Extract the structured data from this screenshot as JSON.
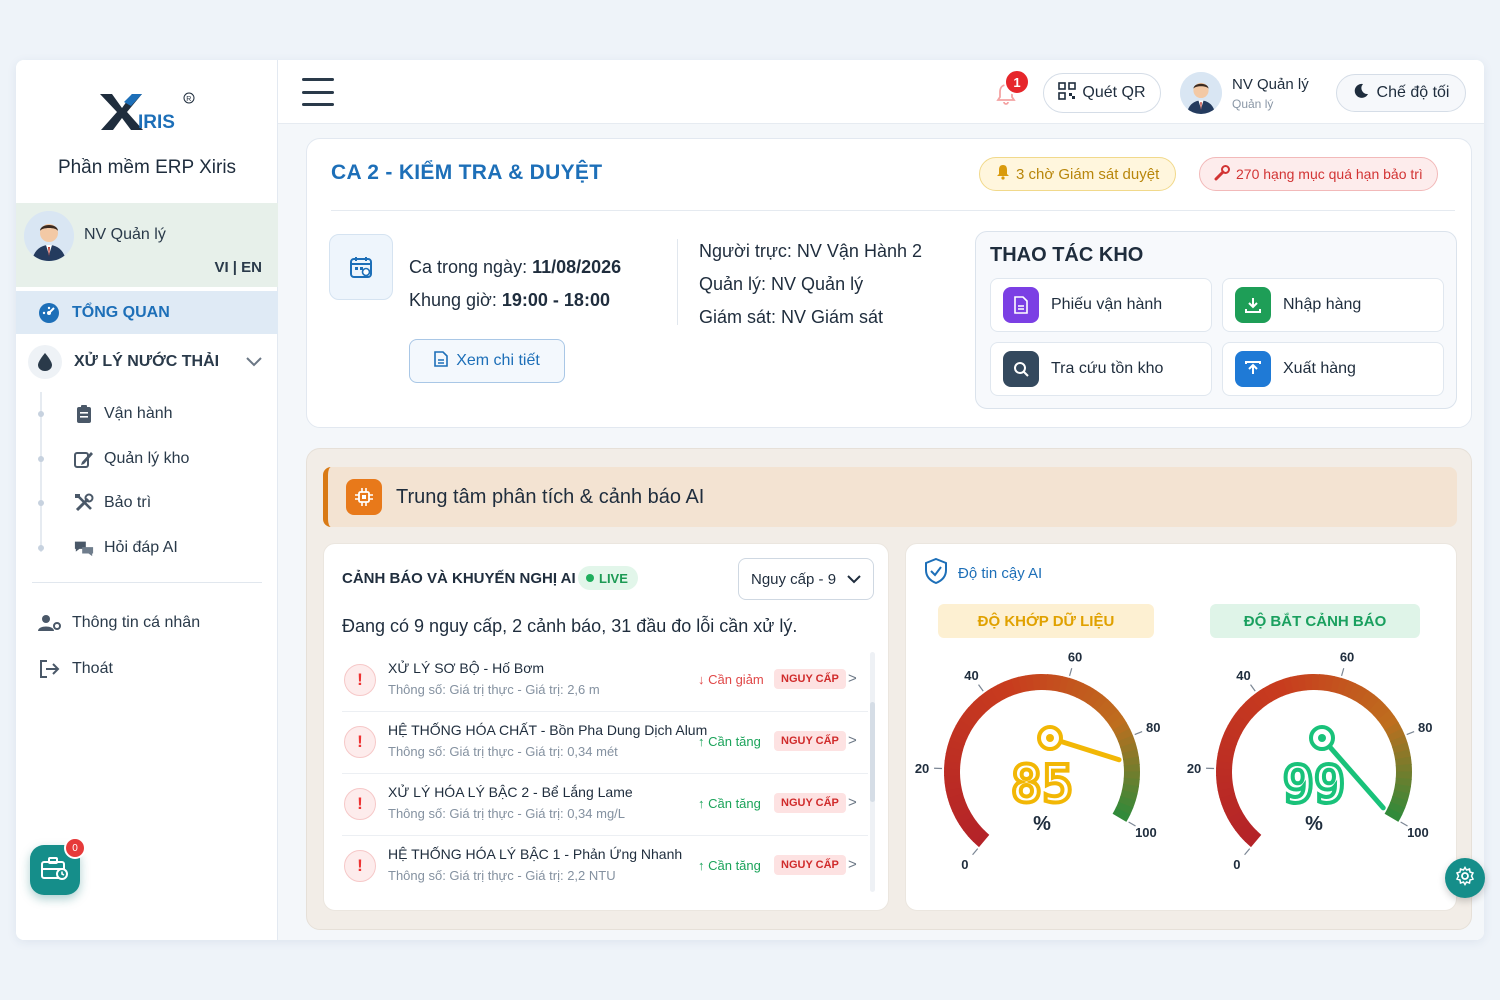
{
  "brand": {
    "logo_text": "XIRIS",
    "app_name": "Phần mềm ERP Xiris"
  },
  "sidebar": {
    "user_name": "NV Quản lý",
    "lang": "VI | EN",
    "overview": "TỔNG QUAN",
    "group": "XỬ LÝ NƯỚC THẢI",
    "sub_items": [
      "Vận hành",
      "Quản lý kho",
      "Bảo trì",
      "Hỏi đáp AI"
    ],
    "profile": "Thông tin cá nhân",
    "logout": "Thoát",
    "fab_badge": "0"
  },
  "topbar": {
    "notif_count": "1",
    "qr_label": "Quét QR",
    "user_name": "NV Quản lý",
    "user_role": "Quản lý",
    "dark_mode": "Chế độ tối"
  },
  "shift": {
    "title": "CA 2 - KIỂM TRA & DUYỆT",
    "pending_badge": "3 chờ Giám sát duyệt",
    "overdue_badge": "270 hạng mục quá hạn bảo trì",
    "date_label": "Ca trong ngày:",
    "date_value": "11/08/2026",
    "time_label": "Khung giờ:",
    "time_value": "19:00 - 18:00",
    "on_duty": "Người trực: NV Vận Hành 2",
    "manager": "Quản lý: NV Quản lý",
    "supervisor": "Giám sát: NV Giám sát",
    "detail_button": "Xem chi tiết"
  },
  "warehouse": {
    "title": "THAO TÁC KHO",
    "actions": [
      {
        "label": "Phiếu vận hành",
        "color": "#7b3fe4"
      },
      {
        "label": "Nhập hàng",
        "color": "#1e9e57"
      },
      {
        "label": "Tra cứu tồn kho",
        "color": "#34495e"
      },
      {
        "label": "Xuất hàng",
        "color": "#1f7ad6"
      }
    ]
  },
  "ai": {
    "title": "Trung tâm phân tích & cảnh báo AI",
    "alerts_title": "CẢNH BÁO VÀ KHUYẾN NGHỊ AI",
    "live": "LIVE",
    "filter": "Nguy cấp - 9",
    "summary": "Đang có 9 nguy cấp, 2 cảnh báo, 31 đầu đo lỗi cần xử lý.",
    "alerts": [
      {
        "title": "XỬ LÝ SƠ BỘ - Hố Bơm",
        "sub": "Thông số: Giá trị thực - Giá trị: 2,6 m",
        "dir": "↓ Cần giảm",
        "dir_color": "#e04848",
        "tag": "NGUY CẤP"
      },
      {
        "title": "HỆ THỐNG HÓA CHẤT - Bồn Pha Dung Dịch Alum",
        "sub": "Thông số: Giá trị thực - Giá trị: 0,34 mét",
        "dir": "↑ Cần tăng",
        "dir_color": "#1ba35a",
        "tag": "NGUY CẤP"
      },
      {
        "title": "XỬ LÝ HÓA LÝ BẬC 2 - Bể Lắng Lame",
        "sub": "Thông số: Giá trị thực - Giá trị: 0,34 mg/L",
        "dir": "↑ Cần tăng",
        "dir_color": "#1ba35a",
        "tag": "NGUY CẤP"
      },
      {
        "title": "HỆ THỐNG HÓA LÝ BẬC 1 - Phản Ứng Nhanh",
        "sub": "Thông số: Giá trị thực - Giá trị: 2,2 NTU",
        "dir": "↑ Cần tăng",
        "dir_color": "#1ba35a",
        "tag": "NGUY CẤP"
      }
    ],
    "trust_title": "Độ tin cậy AI",
    "gauges": [
      {
        "label": "ĐỘ KHỚP DỮ LIỆU",
        "value": 85,
        "unit": "%",
        "color": "#f2b705",
        "label_bg": "#fdf0d2",
        "label_color": "#e0a100",
        "ticks": [
          "0",
          "20",
          "40",
          "60",
          "80",
          "100"
        ]
      },
      {
        "label": "ĐỘ BẮT CẢNH BÁO",
        "value": 99,
        "unit": "%",
        "color": "#19c27a",
        "label_bg": "#dff4e8",
        "label_color": "#1aa05f",
        "ticks": [
          "0",
          "20",
          "40",
          "60",
          "80",
          "100"
        ]
      }
    ]
  }
}
